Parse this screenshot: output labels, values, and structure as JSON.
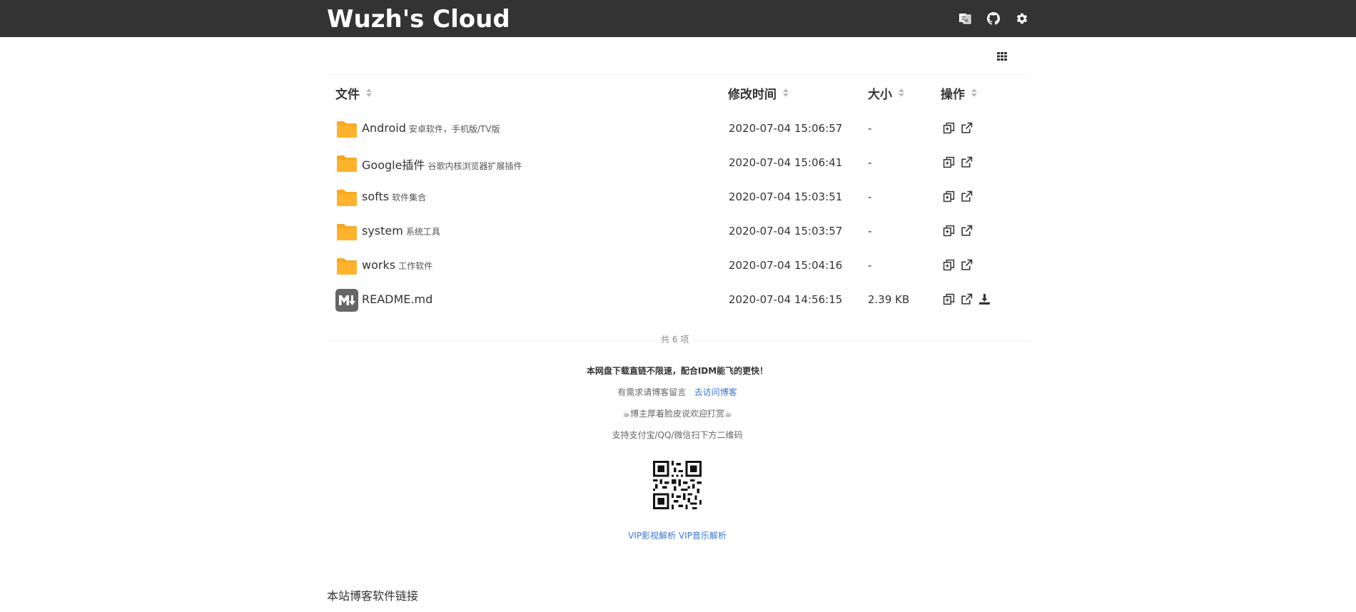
{
  "header": {
    "title": "Wuzh's Cloud"
  },
  "columns": {
    "file": "文件",
    "modified": "修改时间",
    "size": "大小",
    "actions": "操作"
  },
  "rows": [
    {
      "name": "Android",
      "desc": "安卓软件，手机版/TV版",
      "time": "2020-07-04 15:06:57",
      "size": "-",
      "type": "folder"
    },
    {
      "name": "Google插件",
      "desc": "谷歌内核浏览器扩展插件",
      "time": "2020-07-04 15:06:41",
      "size": "-",
      "type": "folder"
    },
    {
      "name": "softs",
      "desc": "软件集合",
      "time": "2020-07-04 15:03:51",
      "size": "-",
      "type": "folder"
    },
    {
      "name": "system",
      "desc": "系统工具",
      "time": "2020-07-04 15:03:57",
      "size": "-",
      "type": "folder"
    },
    {
      "name": "works",
      "desc": "工作软件",
      "time": "2020-07-04 15:04:16",
      "size": "-",
      "type": "folder"
    },
    {
      "name": "README.md",
      "desc": "",
      "time": "2020-07-04 14:56:15",
      "size": "2.39 KB",
      "type": "markdown"
    }
  ],
  "count_text": "共 6 项",
  "footer": {
    "line1": "本网盘下载直链不限速，配合IDM能飞的更快！",
    "line2_prefix": "有需求请博客留言",
    "line2_link": "去访问博客",
    "line3": "☕博主厚着脸皮说欢迎打赏☕",
    "line4": "支持支付宝/QQ/微信扫下方二维码",
    "links": [
      "VIP影视解析",
      "VIP音乐解析"
    ]
  },
  "bottom_title": "本站博客软件链接",
  "colors": {
    "topbar": "#333333",
    "folder": "#FFB32C",
    "link": "#3a76d8"
  }
}
